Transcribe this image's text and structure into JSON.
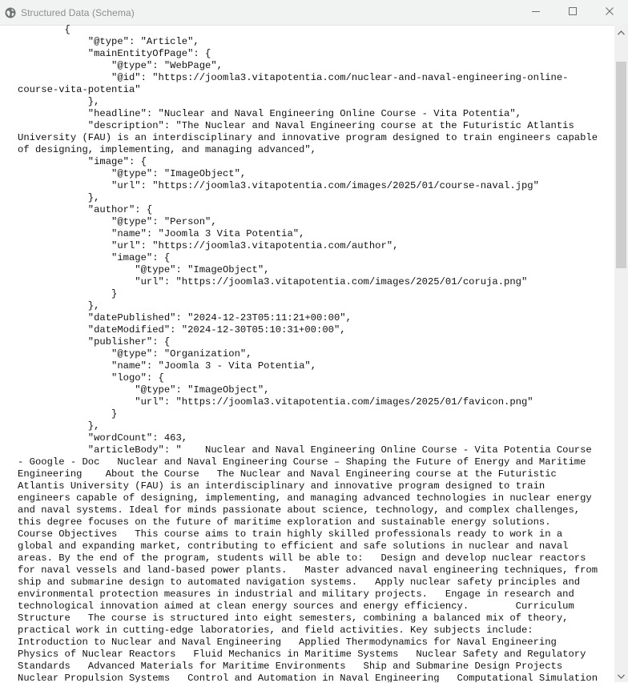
{
  "window": {
    "title": "Structured Data (Schema)",
    "icon": "globe-icon",
    "controls": [
      "minimize-icon",
      "maximize-icon",
      "close-icon"
    ]
  },
  "content": {
    "text": "        {\n            \"@type\": \"Article\",\n            \"mainEntityOfPage\": {\n                \"@type\": \"WebPage\",\n                \"@id\": \"https://joomla3.vitapotentia.com/nuclear-and-naval-engineering-online-course-vita-potentia\"\n            },\n            \"headline\": \"Nuclear and Naval Engineering Online Course - Vita Potentia\",\n            \"description\": \"The Nuclear and Naval Engineering course at the Futuristic Atlantis University (FAU) is an interdisciplinary and innovative program designed to train engineers capable of designing, implementing, and managing advanced\",\n            \"image\": {\n                \"@type\": \"ImageObject\",\n                \"url\": \"https://joomla3.vitapotentia.com/images/2025/01/course-naval.jpg\"\n            },\n            \"author\": {\n                \"@type\": \"Person\",\n                \"name\": \"Joomla 3 Vita Potentia\",\n                \"url\": \"https://joomla3.vitapotentia.com/author\",\n                \"image\": {\n                    \"@type\": \"ImageObject\",\n                    \"url\": \"https://joomla3.vitapotentia.com/images/2025/01/coruja.png\"\n                }\n            },\n            \"datePublished\": \"2024-12-23T05:11:21+00:00\",\n            \"dateModified\": \"2024-12-30T05:10:31+00:00\",\n            \"publisher\": {\n                \"@type\": \"Organization\",\n                \"name\": \"Joomla 3 - Vita Potentia\",\n                \"logo\": {\n                    \"@type\": \"ImageObject\",\n                    \"url\": \"https://joomla3.vitapotentia.com/images/2025/01/favicon.png\"\n                }\n            },\n            \"wordCount\": 463,\n            \"articleBody\": \"    Nuclear and Naval Engineering Online Course - Vita Potentia Course - Google - Doc   Nuclear and Naval Engineering Course – Shaping the Future of Energy and Maritime Engineering    About the Course   The Nuclear and Naval Engineering course at the Futuristic Atlantis University (FAU) is an interdisciplinary and innovative program designed to train engineers capable of designing, implementing, and managing advanced technologies in nuclear energy and naval systems. Ideal for minds passionate about science, technology, and complex challenges, this degree focuses on the future of maritime exploration and sustainable energy solutions.      Course Objectives   This course aims to train highly skilled professionals ready to work in a global and expanding market, contributing to efficient and safe solutions in nuclear and naval areas. By the end of the program, students will be able to:   Design and develop nuclear reactors for naval vessels and land-based power plants.   Master advanced naval engineering techniques, from ship and submarine design to automated navigation systems.   Apply nuclear safety principles and environmental protection measures in industrial and military projects.   Engage in research and technological innovation aimed at clean energy sources and energy efficiency.        Curriculum Structure   The course is structured into eight semesters, combining a balanced mix of theory, practical work in cutting-edge laboratories, and field activities. Key subjects include:   Introduction to Nuclear and Naval Engineering   Applied Thermodynamics for Naval Engineering   Physics of Nuclear Reactors   Fluid Mechanics in Maritime Systems   Nuclear Safety and Regulatory Standards   Advanced Materials for Maritime Environments   Ship and Submarine Design Projects   Nuclear Propulsion Systems   Control and Automation in Naval Engineering   Computational Simulation of Nuclear and Naval Systems     In addition to theoretical"
  },
  "scrollbar": {
    "position_fraction": 0.0,
    "icons": [
      "scroll-up-arrow-icon",
      "scroll-down-arrow-icon"
    ]
  }
}
